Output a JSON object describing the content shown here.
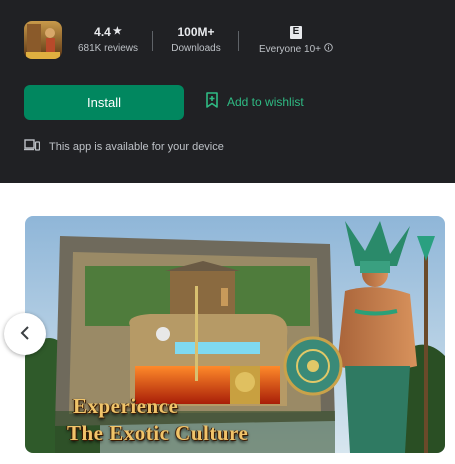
{
  "app": {
    "icon_name": "app-icon"
  },
  "stats": {
    "rating_value": "4.4",
    "rating_star": "★",
    "reviews_label": "681K reviews",
    "downloads_value": "100M+",
    "downloads_label": "Downloads",
    "content_rating_badge": "E",
    "content_rating_label": "Everyone 10+",
    "info_icon": "info-icon"
  },
  "actions": {
    "install_label": "Install",
    "wishlist_label": "Add to wishlist",
    "wishlist_icon": "bookmark-add-icon"
  },
  "availability": {
    "text": "This app is available for your device",
    "icon": "devices-icon"
  },
  "screenshot": {
    "caption_line1": "Experience",
    "caption_line2": "The Exotic Culture"
  },
  "carousel": {
    "prev_icon": "chevron-left-icon"
  },
  "colors": {
    "top_bg": "#202124",
    "install_bg": "#01875f",
    "accent_green": "#2fbb84",
    "caption_gold": "#f0c46a"
  }
}
